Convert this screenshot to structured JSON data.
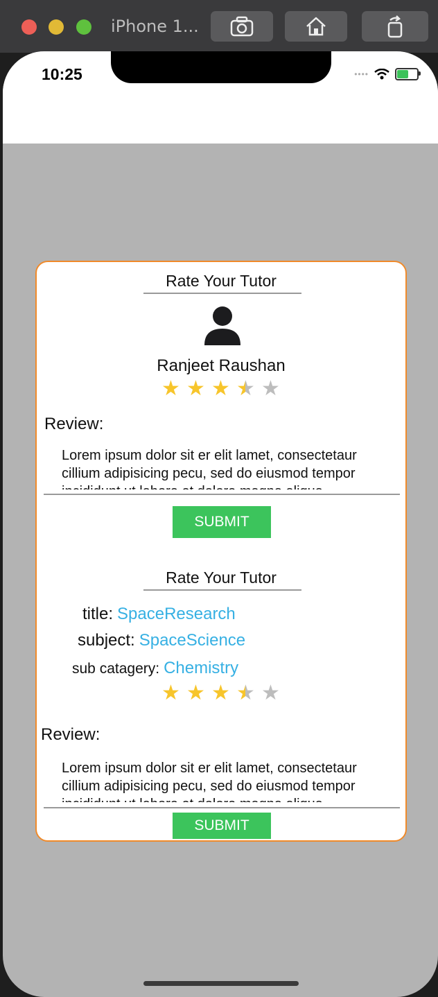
{
  "window": {
    "title": "iPhone 1...",
    "buttons": [
      "screenshot",
      "home",
      "rotate"
    ]
  },
  "status_bar": {
    "time": "10:25"
  },
  "colors": {
    "accent_border": "#f08a2a",
    "submit_bg": "#3cc45c",
    "link": "#36b0e3",
    "star_filled": "#f7c52b",
    "star_empty": "#bdbdbd",
    "overlay_bg": "#b3b3b3"
  },
  "tutor_card": {
    "title": "Rate Your Tutor",
    "avatar_icon": "person-icon",
    "name": "Ranjeet Raushan",
    "rating": 3.5,
    "rating_max": 5,
    "review_label": "Review:",
    "review_text": "Lorem ipsum dolor sit er elit lamet, consectetaur cillium adipisicing pecu, sed do eiusmod tempor incididunt ut labore et dolore magna aliqua.",
    "submit_label": "SUBMIT"
  },
  "course_card": {
    "title": "Rate Your Tutor",
    "fields": [
      {
        "key": "title:",
        "value": "SpaceResearch"
      },
      {
        "key": "subject:",
        "value": "SpaceScience"
      },
      {
        "key": "sub catagery:",
        "value": "Chemistry"
      }
    ],
    "rating": 3.5,
    "rating_max": 5,
    "review_label": "Review:",
    "review_text": "Lorem ipsum dolor sit er elit lamet, consectetaur cillium adipisicing pecu, sed do eiusmod tempor incididunt ut labore et dolore magna aliqua.",
    "submit_label": "SUBMIT"
  }
}
